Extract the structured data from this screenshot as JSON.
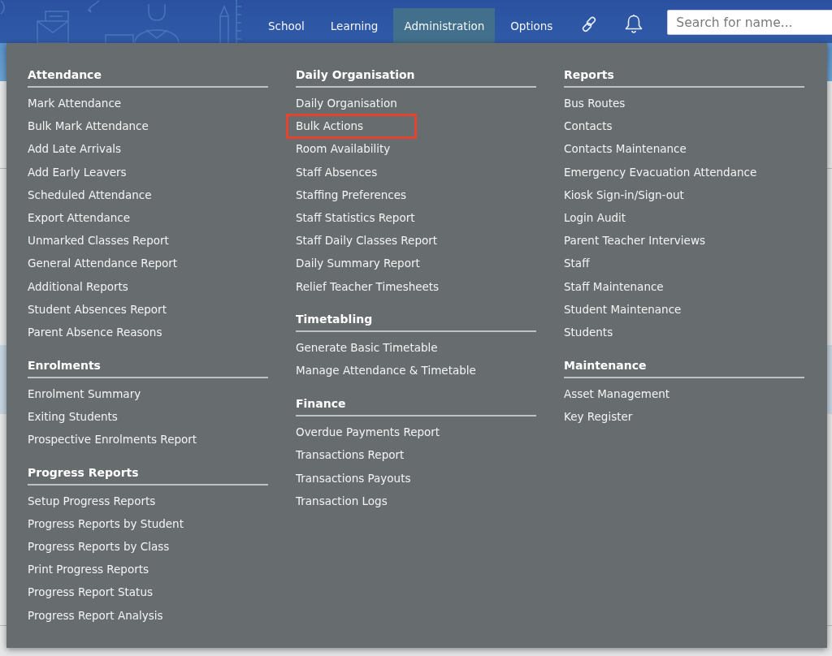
{
  "header": {
    "nav": [
      {
        "label": "School",
        "selected": false
      },
      {
        "label": "Learning",
        "selected": false
      },
      {
        "label": "Administration",
        "selected": true
      },
      {
        "label": "Options",
        "selected": false
      }
    ],
    "search": {
      "placeholder": "Search for name..."
    }
  },
  "menu": {
    "columns": [
      {
        "sections": [
          {
            "title": "Attendance",
            "items": [
              {
                "label": "Mark Attendance",
                "highlighted": false
              },
              {
                "label": "Bulk Mark Attendance",
                "highlighted": false
              },
              {
                "label": "Add Late Arrivals",
                "highlighted": false
              },
              {
                "label": "Add Early Leavers",
                "highlighted": false
              },
              {
                "label": "Scheduled Attendance",
                "highlighted": false
              },
              {
                "label": "Export Attendance",
                "highlighted": false
              },
              {
                "label": "Unmarked Classes Report",
                "highlighted": false
              },
              {
                "label": "General Attendance Report",
                "highlighted": false
              },
              {
                "label": "Additional Reports",
                "highlighted": false
              },
              {
                "label": "Student Absences Report",
                "highlighted": false
              },
              {
                "label": "Parent Absence Reasons",
                "highlighted": false
              }
            ]
          },
          {
            "title": "Enrolments",
            "items": [
              {
                "label": "Enrolment Summary",
                "highlighted": false
              },
              {
                "label": "Exiting Students",
                "highlighted": false
              },
              {
                "label": "Prospective Enrolments Report",
                "highlighted": false
              }
            ]
          },
          {
            "title": "Progress Reports",
            "items": [
              {
                "label": "Setup Progress Reports",
                "highlighted": false
              },
              {
                "label": "Progress Reports by Student",
                "highlighted": false
              },
              {
                "label": "Progress Reports by Class",
                "highlighted": false
              },
              {
                "label": "Print Progress Reports",
                "highlighted": false
              },
              {
                "label": "Progress Report Status",
                "highlighted": false
              },
              {
                "label": "Progress Report Analysis",
                "highlighted": false
              }
            ]
          }
        ]
      },
      {
        "sections": [
          {
            "title": "Daily Organisation",
            "items": [
              {
                "label": "Daily Organisation",
                "highlighted": false
              },
              {
                "label": "Bulk Actions",
                "highlighted": true
              },
              {
                "label": "Room Availability",
                "highlighted": false
              },
              {
                "label": "Staff Absences",
                "highlighted": false
              },
              {
                "label": "Staffing Preferences",
                "highlighted": false
              },
              {
                "label": "Staff Statistics Report",
                "highlighted": false
              },
              {
                "label": "Staff Daily Classes Report",
                "highlighted": false
              },
              {
                "label": "Daily Summary Report",
                "highlighted": false
              },
              {
                "label": "Relief Teacher Timesheets",
                "highlighted": false
              }
            ]
          },
          {
            "title": "Timetabling",
            "items": [
              {
                "label": "Generate Basic Timetable",
                "highlighted": false
              },
              {
                "label": "Manage Attendance & Timetable",
                "highlighted": false
              }
            ]
          },
          {
            "title": "Finance",
            "items": [
              {
                "label": "Overdue Payments Report",
                "highlighted": false
              },
              {
                "label": "Transactions Report",
                "highlighted": false
              },
              {
                "label": "Transactions Payouts",
                "highlighted": false
              },
              {
                "label": "Transaction Logs",
                "highlighted": false
              }
            ]
          }
        ]
      },
      {
        "sections": [
          {
            "title": "Reports",
            "items": [
              {
                "label": "Bus Routes",
                "highlighted": false
              },
              {
                "label": "Contacts",
                "highlighted": false
              },
              {
                "label": "Contacts Maintenance",
                "highlighted": false
              },
              {
                "label": "Emergency Evacuation Attendance",
                "highlighted": false
              },
              {
                "label": "Kiosk Sign-in/Sign-out",
                "highlighted": false
              },
              {
                "label": "Login Audit",
                "highlighted": false
              },
              {
                "label": "Parent Teacher Interviews",
                "highlighted": false
              },
              {
                "label": "Staff",
                "highlighted": false
              },
              {
                "label": "Staff Maintenance",
                "highlighted": false
              },
              {
                "label": "Student Maintenance",
                "highlighted": false
              },
              {
                "label": "Students",
                "highlighted": false
              }
            ]
          },
          {
            "title": "Maintenance",
            "items": [
              {
                "label": "Asset Management",
                "highlighted": false
              },
              {
                "label": "Key Register",
                "highlighted": false
              }
            ]
          }
        ]
      }
    ]
  }
}
